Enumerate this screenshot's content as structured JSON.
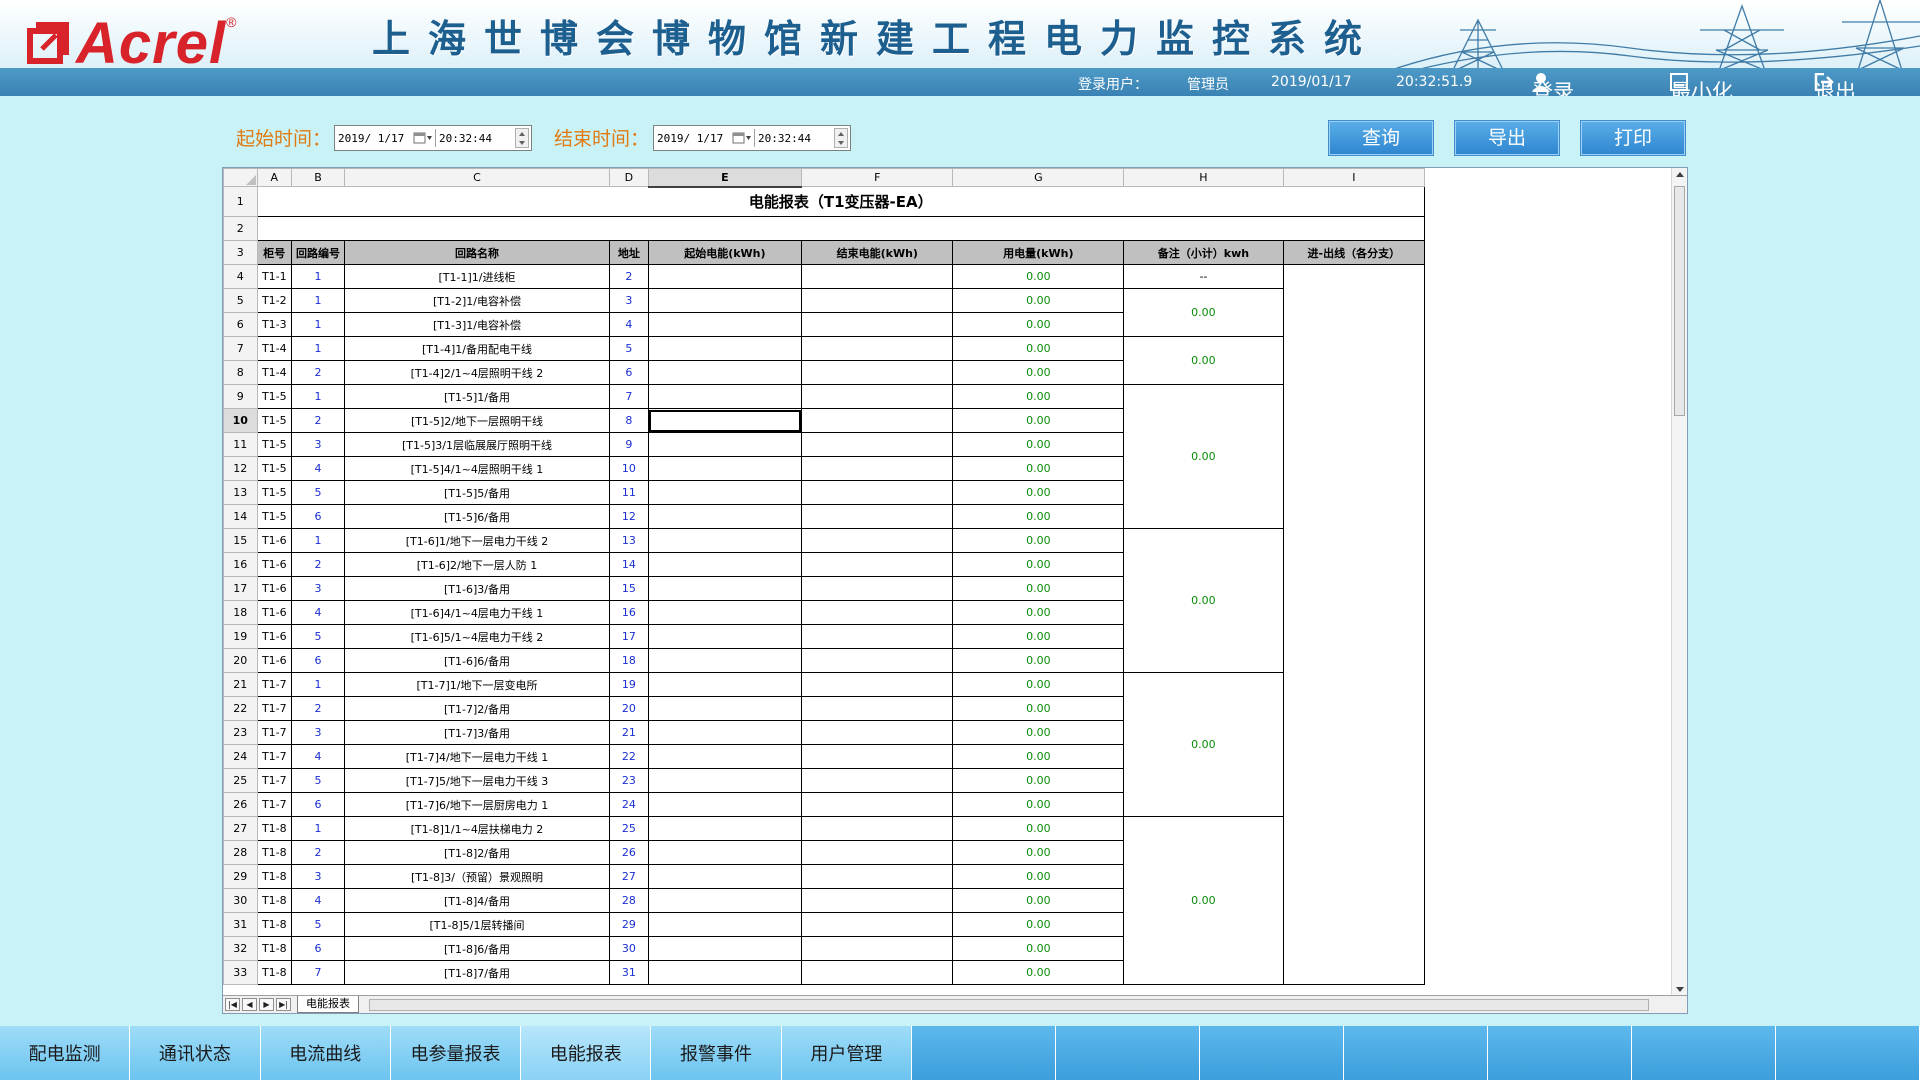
{
  "header": {
    "brand": "Acrel",
    "brand_reg": "®",
    "title": "上海世博会博物馆新建工程电力监控系统",
    "login_user_label": "登录用户：",
    "login_user": "管理员",
    "date": "2019/01/17",
    "time": "20:32:51.9",
    "login_btn": "登录",
    "minimize_btn": "最小化",
    "logout_btn": "退出"
  },
  "query": {
    "start_label": "起始时间：",
    "start_date": "2019/ 1/17",
    "start_time": "20:32:44",
    "end_label": "结束时间：",
    "end_date": "2019/ 1/17",
    "end_time": "20:32:44",
    "query_btn": "查询",
    "export_btn": "导出",
    "print_btn": "打印"
  },
  "sheet": {
    "columns": [
      "A",
      "B",
      "C",
      "D",
      "E",
      "F",
      "G",
      "H",
      "I"
    ],
    "selected_column": "E",
    "selected_row": "10",
    "title": "电能报表（T1变压器-EA）",
    "headers": [
      "柜号",
      "回路编号",
      "回路名称",
      "地址",
      "起始电能(kWh)",
      "结束电能(kWh)",
      "用电量(kWh)",
      "备注（小计）kwh",
      "进-出线（各分支）"
    ],
    "rows": [
      {
        "rn": "4",
        "cab": "T1-1",
        "no": "1",
        "name": "[T1-1]1/进线柜",
        "addr": "2",
        "use": "0.00"
      },
      {
        "rn": "5",
        "cab": "T1-2",
        "no": "1",
        "name": "[T1-2]1/电容补偿",
        "addr": "3",
        "use": "0.00"
      },
      {
        "rn": "6",
        "cab": "T1-3",
        "no": "1",
        "name": "[T1-3]1/电容补偿",
        "addr": "4",
        "use": "0.00"
      },
      {
        "rn": "7",
        "cab": "T1-4",
        "no": "1",
        "name": "[T1-4]1/备用配电干线",
        "addr": "5",
        "use": "0.00"
      },
      {
        "rn": "8",
        "cab": "T1-4",
        "no": "2",
        "name": "[T1-4]2/1~4层照明干线 2",
        "addr": "6",
        "use": "0.00"
      },
      {
        "rn": "9",
        "cab": "T1-5",
        "no": "1",
        "name": "[T1-5]1/备用",
        "addr": "7",
        "use": "0.00"
      },
      {
        "rn": "10",
        "cab": "T1-5",
        "no": "2",
        "name": "[T1-5]2/地下一层照明干线",
        "addr": "8",
        "use": "0.00"
      },
      {
        "rn": "11",
        "cab": "T1-5",
        "no": "3",
        "name": "[T1-5]3/1层临展展厅照明干线",
        "addr": "9",
        "use": "0.00"
      },
      {
        "rn": "12",
        "cab": "T1-5",
        "no": "4",
        "name": "[T1-5]4/1~4层照明干线 1",
        "addr": "10",
        "use": "0.00"
      },
      {
        "rn": "13",
        "cab": "T1-5",
        "no": "5",
        "name": "[T1-5]5/备用",
        "addr": "11",
        "use": "0.00"
      },
      {
        "rn": "14",
        "cab": "T1-5",
        "no": "6",
        "name": "[T1-5]6/备用",
        "addr": "12",
        "use": "0.00"
      },
      {
        "rn": "15",
        "cab": "T1-6",
        "no": "1",
        "name": "[T1-6]1/地下一层电力干线 2",
        "addr": "13",
        "use": "0.00"
      },
      {
        "rn": "16",
        "cab": "T1-6",
        "no": "2",
        "name": "[T1-6]2/地下一层人防 1",
        "addr": "14",
        "use": "0.00"
      },
      {
        "rn": "17",
        "cab": "T1-6",
        "no": "3",
        "name": "[T1-6]3/备用",
        "addr": "15",
        "use": "0.00"
      },
      {
        "rn": "18",
        "cab": "T1-6",
        "no": "4",
        "name": "[T1-6]4/1~4层电力干线 1",
        "addr": "16",
        "use": "0.00"
      },
      {
        "rn": "19",
        "cab": "T1-6",
        "no": "5",
        "name": "[T1-6]5/1~4层电力干线 2",
        "addr": "17",
        "use": "0.00"
      },
      {
        "rn": "20",
        "cab": "T1-6",
        "no": "6",
        "name": "[T1-6]6/备用",
        "addr": "18",
        "use": "0.00"
      },
      {
        "rn": "21",
        "cab": "T1-7",
        "no": "1",
        "name": "[T1-7]1/地下一层变电所",
        "addr": "19",
        "use": "0.00"
      },
      {
        "rn": "22",
        "cab": "T1-7",
        "no": "2",
        "name": "[T1-7]2/备用",
        "addr": "20",
        "use": "0.00"
      },
      {
        "rn": "23",
        "cab": "T1-7",
        "no": "3",
        "name": "[T1-7]3/备用",
        "addr": "21",
        "use": "0.00"
      },
      {
        "rn": "24",
        "cab": "T1-7",
        "no": "4",
        "name": "[T1-7]4/地下一层电力干线 1",
        "addr": "22",
        "use": "0.00"
      },
      {
        "rn": "25",
        "cab": "T1-7",
        "no": "5",
        "name": "[T1-7]5/地下一层电力干线 3",
        "addr": "23",
        "use": "0.00"
      },
      {
        "rn": "26",
        "cab": "T1-7",
        "no": "6",
        "name": "[T1-7]6/地下一层厨房电力 1",
        "addr": "24",
        "use": "0.00"
      },
      {
        "rn": "27",
        "cab": "T1-8",
        "no": "1",
        "name": "[T1-8]1/1~4层扶梯电力 2",
        "addr": "25",
        "use": "0.00"
      },
      {
        "rn": "28",
        "cab": "T1-8",
        "no": "2",
        "name": "[T1-8]2/备用",
        "addr": "26",
        "use": "0.00"
      },
      {
        "rn": "29",
        "cab": "T1-8",
        "no": "3",
        "name": "[T1-8]3/（预留）景观照明",
        "addr": "27",
        "use": "0.00"
      },
      {
        "rn": "30",
        "cab": "T1-8",
        "no": "4",
        "name": "[T1-8]4/备用",
        "addr": "28",
        "use": "0.00"
      },
      {
        "rn": "31",
        "cab": "T1-8",
        "no": "5",
        "name": "[T1-8]5/1层转播间",
        "addr": "29",
        "use": "0.00"
      },
      {
        "rn": "32",
        "cab": "T1-8",
        "no": "6",
        "name": "[T1-8]6/备用",
        "addr": "30",
        "use": "0.00"
      },
      {
        "rn": "33",
        "cab": "T1-8",
        "no": "7",
        "name": "[T1-8]7/备用",
        "addr": "31",
        "use": "0.00"
      }
    ],
    "subtotals": [
      {
        "first_row": "4",
        "span": 1,
        "value": "--"
      },
      {
        "first_row": "5",
        "span": 2,
        "value": "0.00"
      },
      {
        "first_row": "7",
        "span": 2,
        "value": "0.00"
      },
      {
        "first_row": "9",
        "span": 6,
        "value": "0.00"
      },
      {
        "first_row": "15",
        "span": 6,
        "value": "0.00"
      },
      {
        "first_row": "21",
        "span": 6,
        "value": "0.00"
      },
      {
        "first_row": "27",
        "span": 7,
        "value": "0.00"
      }
    ],
    "sheet_tab": "电能报表"
  },
  "nav": {
    "items": [
      "配电监测",
      "通讯状态",
      "电流曲线",
      "电参量报表",
      "电能报表",
      "报警事件",
      "用户管理"
    ],
    "active": "电能报表"
  }
}
